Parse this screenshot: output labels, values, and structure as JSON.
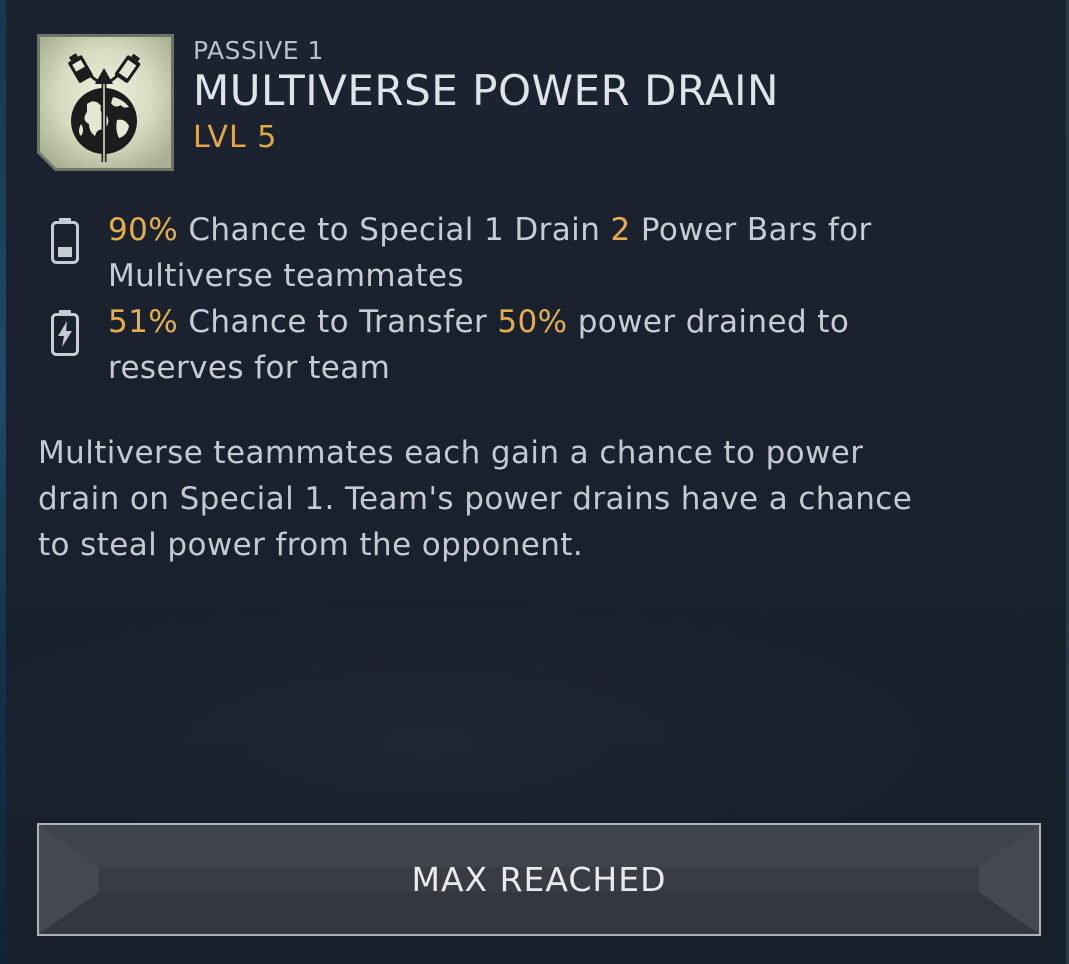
{
  "ability": {
    "icon": "power-drain-globe-icon",
    "slot": "PASSIVE 1",
    "name": "MULTIVERSE POWER DRAIN",
    "level": "LVL 5"
  },
  "stats": [
    {
      "icon": "battery-low-icon",
      "value1": "90%",
      "text1": " Chance to Special 1 Drain ",
      "value2": "2",
      "text2": " Power Bars for Multiverse teammates"
    },
    {
      "icon": "battery-charge-icon",
      "value1": "51%",
      "text1": " Chance to Transfer ",
      "value2": "50%",
      "text2": " power drained to reserves for team"
    }
  ],
  "description": "Multiverse teammates each gain a chance to power drain on Special 1. Team's power drains have a chance to steal power from the opponent.",
  "button": {
    "label": "MAX REACHED"
  },
  "colors": {
    "highlight": "#e5ad4c",
    "background": "#1b2230",
    "level": "#e0a847"
  }
}
